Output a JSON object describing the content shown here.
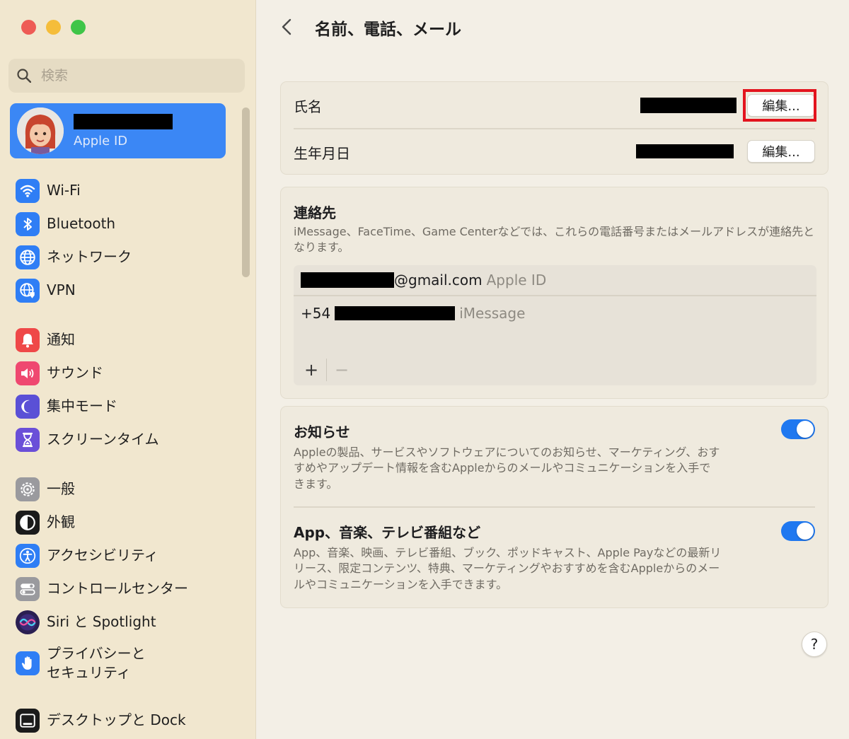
{
  "window": {
    "title": "名前、電話、メール"
  },
  "sidebar": {
    "search_placeholder": "検索",
    "account": {
      "label": "Apple ID"
    },
    "groups": [
      {
        "items": [
          {
            "key": "wifi",
            "label": "Wi-Fi",
            "icon": "wifi-icon",
            "color": "#2f7ef5"
          },
          {
            "key": "bluetooth",
            "label": "Bluetooth",
            "icon": "bluetooth-icon",
            "color": "#2f7ef5"
          },
          {
            "key": "network",
            "label": "ネットワーク",
            "icon": "globe-icon",
            "color": "#2f7ef5"
          },
          {
            "key": "vpn",
            "label": "VPN",
            "icon": "vpn-globe-icon",
            "color": "#2f7ef5"
          }
        ]
      },
      {
        "items": [
          {
            "key": "notifications",
            "label": "通知",
            "icon": "bell-icon",
            "color": "#ef4848"
          },
          {
            "key": "sound",
            "label": "サウンド",
            "icon": "speaker-icon",
            "color": "#ef4870"
          },
          {
            "key": "focus",
            "label": "集中モード",
            "icon": "moon-icon",
            "color": "#5a50d6"
          },
          {
            "key": "screen-time",
            "label": "スクリーンタイム",
            "icon": "hourglass-icon",
            "color": "#6a4fd8"
          }
        ]
      },
      {
        "items": [
          {
            "key": "general",
            "label": "一般",
            "icon": "gear-icon",
            "color": "#9a9a9e"
          },
          {
            "key": "appearance",
            "label": "外観",
            "icon": "appearance-icon",
            "color": "#1b1b1b"
          },
          {
            "key": "accessibility",
            "label": "アクセシビリティ",
            "icon": "accessibility-icon",
            "color": "#2f7ef5"
          },
          {
            "key": "control-center",
            "label": "コントロールセンター",
            "icon": "toggles-icon",
            "color": "#9a9a9e"
          },
          {
            "key": "siri",
            "label": "Siri と Spotlight",
            "icon": "siri-icon",
            "color": "#3a2a6a"
          },
          {
            "key": "privacy",
            "label": "プライバシーと\nセキュリティ",
            "icon": "hand-icon",
            "color": "#2f7ef5"
          }
        ]
      },
      {
        "items": [
          {
            "key": "desktop-dock",
            "label": "デスクトップと Dock",
            "icon": "dock-icon",
            "color": "#1b1b1b"
          }
        ]
      }
    ]
  },
  "main": {
    "identity": {
      "name_label": "氏名",
      "birthday_label": "生年月日",
      "edit_label": "編集..."
    },
    "contact": {
      "title": "連絡先",
      "description": "iMessage、FaceTime、Game Centerなどでは、これらの電話番号またはメールアドレスが連絡先となります。",
      "email_suffix": "@gmail.com",
      "email_tag": "Apple ID",
      "phone_prefix": "+54",
      "phone_tag": "iMessage",
      "add_label": "+",
      "remove_label": "−"
    },
    "announcements": {
      "title": "お知らせ",
      "description": "Appleの製品、サービスやソフトウェアについてのお知らせ、マーケティング、おすすめやアップデート情報を含むAppleからのメールやコミュニケーションを入手できます。",
      "enabled": true
    },
    "apps": {
      "title": "App、音楽、テレビ番組など",
      "description": "App、音楽、映画、テレビ番組、ブック、ポッドキャスト、Apple Payなどの最新リリース、限定コンテンツ、特典、マーケティングやおすすめを含むAppleからのメールやコミュニケーションを入手できます。",
      "enabled": true
    },
    "help_label": "?"
  }
}
